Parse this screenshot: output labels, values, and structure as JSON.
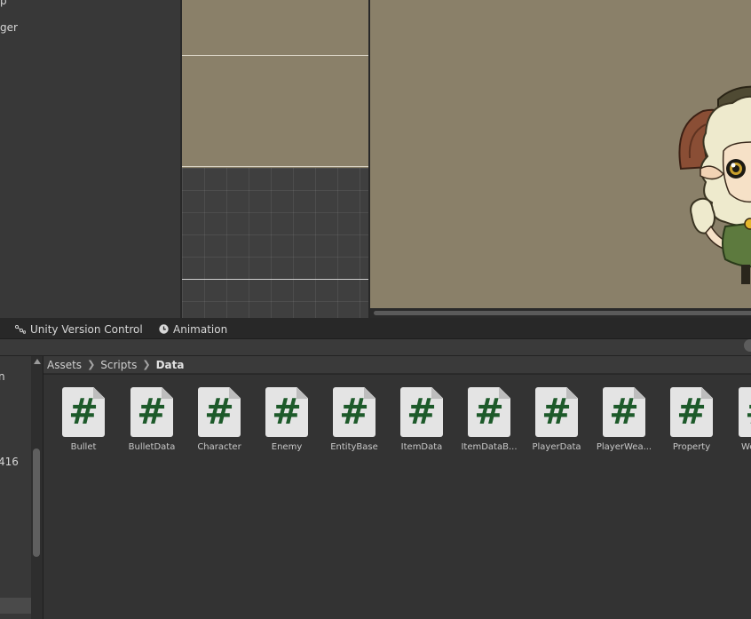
{
  "left_panel": {
    "items": [
      "p",
      "ger"
    ]
  },
  "tabs": [
    {
      "label": "Unity Version Control",
      "icon": "version-control-icon"
    },
    {
      "label": "Animation",
      "icon": "clock-icon"
    }
  ],
  "folder_tree": {
    "fragments": [
      "n",
      "416"
    ]
  },
  "breadcrumb": [
    "Assets",
    "Scripts",
    "Data"
  ],
  "assets": [
    {
      "name": "Bullet",
      "icon": "csharp-script-icon"
    },
    {
      "name": "BulletData",
      "icon": "csharp-script-icon"
    },
    {
      "name": "Character",
      "icon": "csharp-script-icon"
    },
    {
      "name": "Enemy",
      "icon": "csharp-script-icon"
    },
    {
      "name": "EntityBase",
      "icon": "csharp-script-icon"
    },
    {
      "name": "ItemData",
      "icon": "csharp-script-icon"
    },
    {
      "name": "ItemDataB...",
      "icon": "csharp-script-icon"
    },
    {
      "name": "PlayerData",
      "icon": "csharp-script-icon"
    },
    {
      "name": "PlayerWea...",
      "icon": "csharp-script-icon"
    },
    {
      "name": "Property",
      "icon": "csharp-script-icon"
    },
    {
      "name": "We",
      "icon": "csharp-script-icon"
    }
  ],
  "colors": {
    "scene_background": "#8a8069",
    "script_icon_hash": "#1d5a2a",
    "panel_dark": "#383838"
  }
}
